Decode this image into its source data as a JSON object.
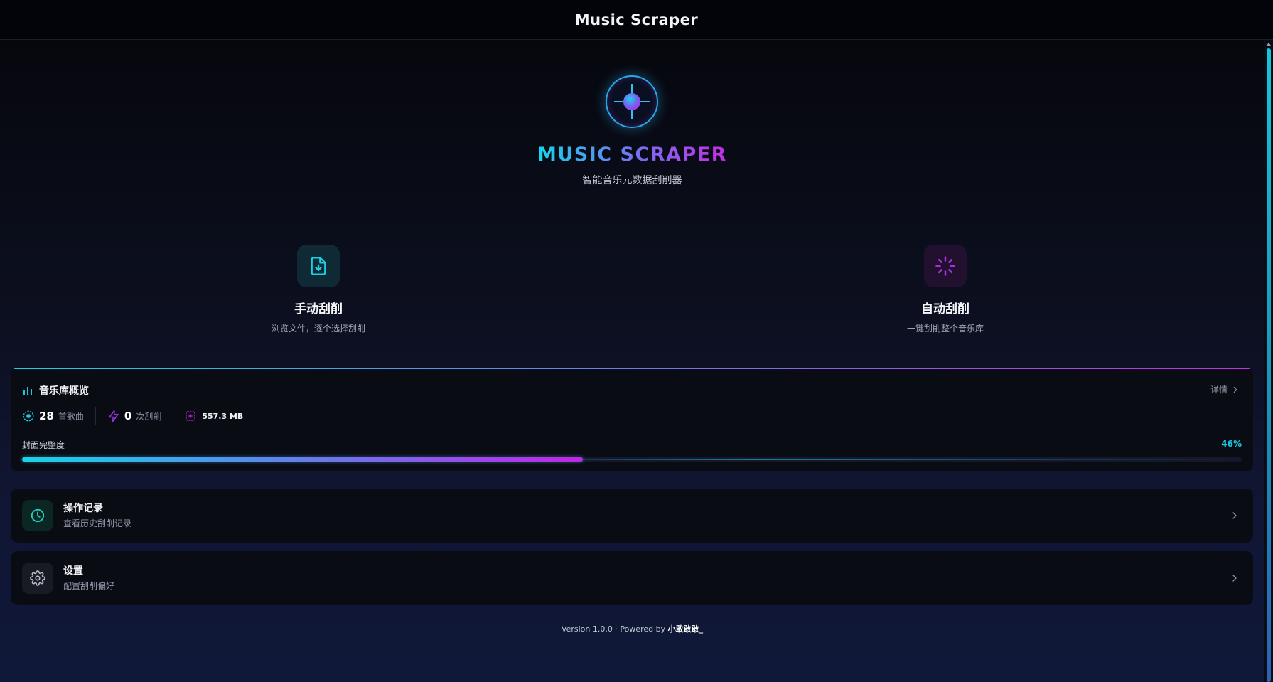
{
  "window": {
    "title": "Music Scraper"
  },
  "hero": {
    "app_name": "MUSIC SCRAPER",
    "tagline": "智能音乐元数据刮削器"
  },
  "modes": [
    {
      "icon": "file-download-icon",
      "title": "手动刮削",
      "desc": "浏览文件，逐个选择刮削",
      "color": "#19d0e6"
    },
    {
      "icon": "loader-icon",
      "title": "自动刮削",
      "desc": "一键刮削整个音乐库",
      "color": "#a62fe0"
    }
  ],
  "overview": {
    "title": "音乐库概览",
    "detail_label": "详情",
    "stats": [
      {
        "icon": "disc-icon",
        "value": "28",
        "unit": "首歌曲"
      },
      {
        "icon": "bolt-icon",
        "value": "0",
        "unit": "次刮削"
      },
      {
        "icon": "storage-icon",
        "value": "557.3 MB"
      }
    ],
    "coverage_label": "封面完整度",
    "coverage_percent_text": "46%",
    "coverage_fraction": 0.46
  },
  "menu": [
    {
      "icon": "clock-icon",
      "title": "操作记录",
      "desc": "查看历史刮削记录"
    },
    {
      "icon": "gear-icon",
      "title": "设置",
      "desc": "配置刮削偏好"
    }
  ],
  "footer": {
    "prefix": "Version 1.0.0 · Powered by ",
    "author": "小敢敢敢_"
  },
  "colors": {
    "accent_cyan": "#19c9e0",
    "accent_purple": "#c42ee6",
    "background": "#0c0f1f"
  }
}
